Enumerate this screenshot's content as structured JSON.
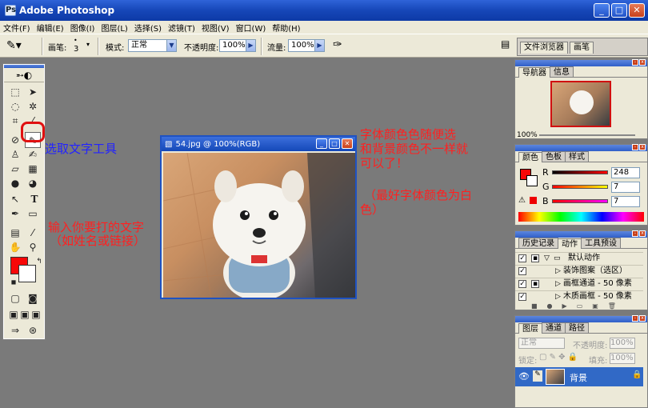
{
  "window": {
    "title": "Adobe Photoshop",
    "app_icon": "Ps"
  },
  "menu": [
    "文件(F)",
    "编辑(E)",
    "图像(I)",
    "图层(L)",
    "选择(S)",
    "滤镜(T)",
    "视图(V)",
    "窗口(W)",
    "帮助(H)"
  ],
  "options": {
    "brush_label": "画笔:",
    "brush_size": "3",
    "mode_label": "模式:",
    "mode_value": "正常",
    "opacity_label": "不透明度:",
    "opacity_value": "100%",
    "flow_label": "流量:",
    "flow_value": "100%",
    "well_tabs": [
      "文件浏览器",
      "画笔"
    ]
  },
  "document": {
    "title": "54.jpg @ 100%(RGB)"
  },
  "annotations": {
    "select_tool": "选取文字工具",
    "type_text": [
      "输入你要打的文字",
      "（如姓名或链接）"
    ],
    "color_hint": [
      "字体颜色色随便选",
      "和背景颜色不一样就",
      "可以了！"
    ],
    "color_best": [
      "（最好字体颜色为白",
      "色）"
    ]
  },
  "navigator": {
    "tabs": [
      "导航器",
      "信息"
    ],
    "zoom": "100%"
  },
  "color_panel": {
    "tabs": [
      "颜色",
      "色板",
      "样式"
    ],
    "channels": [
      {
        "label": "R",
        "value": "248"
      },
      {
        "label": "G",
        "value": "7"
      },
      {
        "label": "B",
        "value": "7"
      }
    ],
    "fg_color": "#f80707"
  },
  "history_panel": {
    "tabs": [
      "历史记录",
      "动作",
      "工具预设"
    ],
    "items": [
      "默认动作",
      "装饰图案（选区）",
      "画框通道 - 50 像素",
      "木质画框 - 50 像素"
    ]
  },
  "layers_panel": {
    "tabs": [
      "图层",
      "通道",
      "路径"
    ],
    "blend": "正常",
    "opacity_label": "不透明度:",
    "opacity_value": "100%",
    "lock_label": "锁定:",
    "fill_label": "填充:",
    "fill_value": "100%",
    "layer_name": "背景"
  }
}
